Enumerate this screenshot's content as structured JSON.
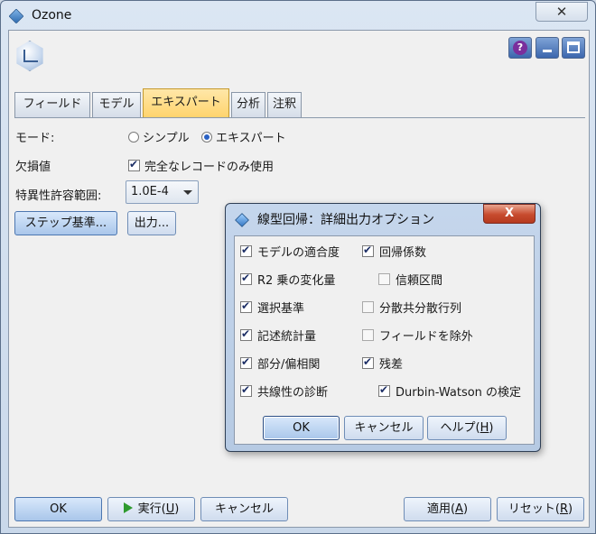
{
  "window": {
    "title": "Ozone",
    "close_symbol": "✕"
  },
  "toolbar": {
    "help_symbol": "?"
  },
  "tabs": [
    {
      "label": "フィールド",
      "active": false
    },
    {
      "label": "モデル",
      "active": false
    },
    {
      "label": "エキスパート",
      "active": true
    },
    {
      "label": "分析",
      "active": false
    },
    {
      "label": "注釈",
      "active": false
    }
  ],
  "mode": {
    "label": "モード:",
    "options": [
      "シンプル",
      "エキスパート"
    ],
    "selected": "エキスパート"
  },
  "missing": {
    "label": "欠損値",
    "checkbox_label": "完全なレコードのみ使用",
    "checked": true
  },
  "singularity": {
    "label": "特異性許容範囲:",
    "value": "1.0E-4"
  },
  "buttons_mid": {
    "step": "ステップ基準...",
    "output": "出力..."
  },
  "dialog": {
    "title": "線型回帰：詳細出力オプション",
    "close_symbol": "X",
    "options_left": [
      {
        "label": "モデルの適合度",
        "checked": true
      },
      {
        "label": "R2 乗の変化量",
        "checked": true
      },
      {
        "label": "選択基準",
        "checked": true
      },
      {
        "label": "記述統計量",
        "checked": true
      },
      {
        "label": "部分/偏相関",
        "checked": true
      },
      {
        "label": "共線性の診断",
        "checked": true
      }
    ],
    "options_right": [
      {
        "label": "回帰係数",
        "checked": true
      },
      {
        "label": "信頼区間",
        "checked": false
      },
      {
        "label": "分散共分散行列",
        "checked": false
      },
      {
        "label": "フィールドを除外",
        "checked": false
      },
      {
        "label": "残差",
        "checked": true
      },
      {
        "label": "Durbin-Watson の検定",
        "checked": true
      }
    ],
    "ok": "OK",
    "cancel": "キャンセル",
    "help_prefix": "ヘルプ(",
    "help_key": "H",
    "help_suffix": ")"
  },
  "footer": {
    "ok": "OK",
    "run_prefix": "実行(",
    "run_key": "U",
    "run_suffix": ")",
    "cancel": "キャンセル",
    "apply_prefix": "適用(",
    "apply_key": "A",
    "apply_suffix": ")",
    "reset_prefix": "リセット(",
    "reset_key": "R",
    "reset_suffix": ")"
  },
  "colors": {
    "active_tab": "#ffd36b",
    "accent": "#2a61c4",
    "dialog_close": "#c74b2e",
    "run_icon": "#2e9a2e"
  }
}
